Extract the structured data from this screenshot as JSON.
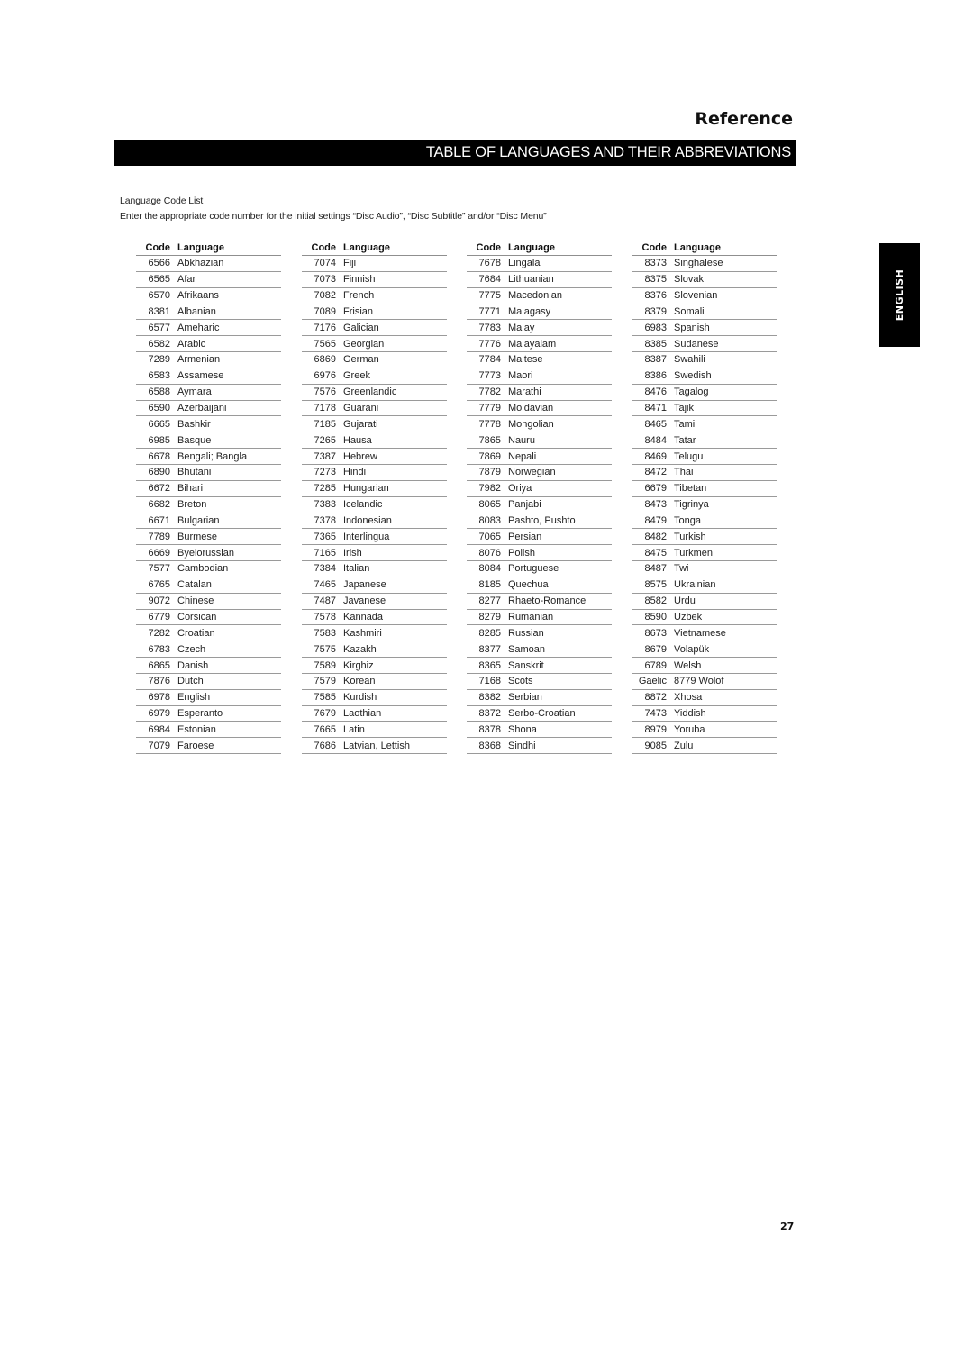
{
  "header": {
    "section": "Reference",
    "title": "TABLE OF LANGUAGES AND THEIR ABBREVIATIONS"
  },
  "intro": {
    "heading": "Language Code List",
    "instruction": "Enter the appropriate code number for the initial settings “Disc Audio”, “Disc Subtitle” and/or “Disc Menu”"
  },
  "table": {
    "code_header": "Code",
    "language_header": "Language",
    "columns": [
      [
        {
          "code": "6566",
          "language": "Abkhazian"
        },
        {
          "code": "6565",
          "language": "Afar"
        },
        {
          "code": "6570",
          "language": "Afrikaans"
        },
        {
          "code": "8381",
          "language": "Albanian"
        },
        {
          "code": "6577",
          "language": "Ameharic"
        },
        {
          "code": "6582",
          "language": "Arabic"
        },
        {
          "code": "7289",
          "language": "Armenian"
        },
        {
          "code": "6583",
          "language": "Assamese"
        },
        {
          "code": "6588",
          "language": "Aymara"
        },
        {
          "code": "6590",
          "language": "Azerbaijani"
        },
        {
          "code": "6665",
          "language": "Bashkir"
        },
        {
          "code": "6985",
          "language": "Basque"
        },
        {
          "code": "6678",
          "language": "Bengali; Bangla"
        },
        {
          "code": "6890",
          "language": "Bhutani"
        },
        {
          "code": "6672",
          "language": "Bihari"
        },
        {
          "code": "6682",
          "language": "Breton"
        },
        {
          "code": "6671",
          "language": "Bulgarian"
        },
        {
          "code": "7789",
          "language": "Burmese"
        },
        {
          "code": "6669",
          "language": "Byelorussian"
        },
        {
          "code": "7577",
          "language": "Cambodian"
        },
        {
          "code": "6765",
          "language": "Catalan"
        },
        {
          "code": "9072",
          "language": "Chinese"
        },
        {
          "code": "6779",
          "language": "Corsican"
        },
        {
          "code": "7282",
          "language": "Croatian"
        },
        {
          "code": "6783",
          "language": "Czech"
        },
        {
          "code": "6865",
          "language": "Danish"
        },
        {
          "code": "7876",
          "language": "Dutch"
        },
        {
          "code": "6978",
          "language": "English"
        },
        {
          "code": "6979",
          "language": "Esperanto"
        },
        {
          "code": "6984",
          "language": "Estonian"
        },
        {
          "code": "7079",
          "language": "Faroese"
        }
      ],
      [
        {
          "code": "7074",
          "language": "Fiji"
        },
        {
          "code": "7073",
          "language": "Finnish"
        },
        {
          "code": "7082",
          "language": "French"
        },
        {
          "code": "7089",
          "language": "Frisian"
        },
        {
          "code": "7176",
          "language": "Galician"
        },
        {
          "code": "7565",
          "language": "Georgian"
        },
        {
          "code": "6869",
          "language": "German"
        },
        {
          "code": "6976",
          "language": "Greek"
        },
        {
          "code": "7576",
          "language": "Greenlandic"
        },
        {
          "code": "7178",
          "language": "Guarani"
        },
        {
          "code": "7185",
          "language": "Gujarati"
        },
        {
          "code": "7265",
          "language": "Hausa"
        },
        {
          "code": "7387",
          "language": "Hebrew"
        },
        {
          "code": "7273",
          "language": "Hindi"
        },
        {
          "code": "7285",
          "language": "Hungarian"
        },
        {
          "code": "7383",
          "language": "Icelandic"
        },
        {
          "code": "7378",
          "language": "Indonesian"
        },
        {
          "code": "7365",
          "language": "Interlingua"
        },
        {
          "code": "7165",
          "language": "Irish"
        },
        {
          "code": "7384",
          "language": "Italian"
        },
        {
          "code": "7465",
          "language": "Japanese"
        },
        {
          "code": "7487",
          "language": "Javanese"
        },
        {
          "code": "7578",
          "language": "Kannada"
        },
        {
          "code": "7583",
          "language": "Kashmiri"
        },
        {
          "code": "7575",
          "language": "Kazakh"
        },
        {
          "code": "7589",
          "language": "Kirghiz"
        },
        {
          "code": "7579",
          "language": "Korean"
        },
        {
          "code": "7585",
          "language": "Kurdish"
        },
        {
          "code": "7679",
          "language": "Laothian"
        },
        {
          "code": "7665",
          "language": "Latin"
        },
        {
          "code": "7686",
          "language": "Latvian, Lettish"
        }
      ],
      [
        {
          "code": "7678",
          "language": "Lingala"
        },
        {
          "code": "7684",
          "language": "Lithuanian"
        },
        {
          "code": "7775",
          "language": "Macedonian"
        },
        {
          "code": "7771",
          "language": "Malagasy"
        },
        {
          "code": "7783",
          "language": "Malay"
        },
        {
          "code": "7776",
          "language": "Malayalam"
        },
        {
          "code": "7784",
          "language": "Maltese"
        },
        {
          "code": "7773",
          "language": "Maori"
        },
        {
          "code": "7782",
          "language": "Marathi"
        },
        {
          "code": "7779",
          "language": "Moldavian"
        },
        {
          "code": "7778",
          "language": "Mongolian"
        },
        {
          "code": "7865",
          "language": "Nauru"
        },
        {
          "code": "7869",
          "language": "Nepali"
        },
        {
          "code": "7879",
          "language": "Norwegian"
        },
        {
          "code": "7982",
          "language": "Oriya"
        },
        {
          "code": "8065",
          "language": "Panjabi"
        },
        {
          "code": "8083",
          "language": "Pashto, Pushto"
        },
        {
          "code": "7065",
          "language": "Persian"
        },
        {
          "code": "8076",
          "language": "Polish"
        },
        {
          "code": "8084",
          "language": "Portuguese"
        },
        {
          "code": "8185",
          "language": "Quechua"
        },
        {
          "code": "8277",
          "language": "Rhaeto-Romance"
        },
        {
          "code": "8279",
          "language": "Rumanian"
        },
        {
          "code": "8285",
          "language": "Russian"
        },
        {
          "code": "8377",
          "language": "Samoan"
        },
        {
          "code": "8365",
          "language": "Sanskrit"
        },
        {
          "code": "7168",
          "language": "Scots"
        },
        {
          "code": "8382",
          "language": "Serbian"
        },
        {
          "code": "8372",
          "language": "Serbo-Croatian"
        },
        {
          "code": "8378",
          "language": "Shona"
        },
        {
          "code": "8368",
          "language": "Sindhi"
        }
      ],
      [
        {
          "code": "8373",
          "language": "Singhalese"
        },
        {
          "code": "8375",
          "language": "Slovak"
        },
        {
          "code": "8376",
          "language": "Slovenian"
        },
        {
          "code": "8379",
          "language": "Somali"
        },
        {
          "code": "6983",
          "language": "Spanish"
        },
        {
          "code": "8385",
          "language": "Sudanese"
        },
        {
          "code": "8387",
          "language": "Swahili"
        },
        {
          "code": "8386",
          "language": "Swedish"
        },
        {
          "code": "8476",
          "language": "Tagalog"
        },
        {
          "code": "8471",
          "language": "Tajik"
        },
        {
          "code": "8465",
          "language": "Tamil"
        },
        {
          "code": "8484",
          "language": "Tatar"
        },
        {
          "code": "8469",
          "language": "Telugu"
        },
        {
          "code": "8472",
          "language": "Thai"
        },
        {
          "code": "6679",
          "language": "Tibetan"
        },
        {
          "code": "8473",
          "language": "Tigrinya"
        },
        {
          "code": "8479",
          "language": "Tonga"
        },
        {
          "code": "8482",
          "language": "Turkish"
        },
        {
          "code": "8475",
          "language": "Turkmen"
        },
        {
          "code": "8487",
          "language": "Twi"
        },
        {
          "code": "8575",
          "language": "Ukrainian"
        },
        {
          "code": "8582",
          "language": "Urdu"
        },
        {
          "code": "8590",
          "language": "Uzbek"
        },
        {
          "code": "8673",
          "language": "Vietnamese"
        },
        {
          "code": "8679",
          "language": "Volapük"
        },
        {
          "code": "6789",
          "language": "Welsh"
        },
        {
          "code": "Gaelic",
          "language": "8779 Wolof"
        },
        {
          "code": "8872",
          "language": "Xhosa"
        },
        {
          "code": "7473",
          "language": "Yiddish"
        },
        {
          "code": "8979",
          "language": "Yoruba"
        },
        {
          "code": "9085",
          "language": "Zulu"
        }
      ]
    ]
  },
  "side_tab": {
    "label": "ENGLISH"
  },
  "footer": {
    "page_number": "27"
  }
}
